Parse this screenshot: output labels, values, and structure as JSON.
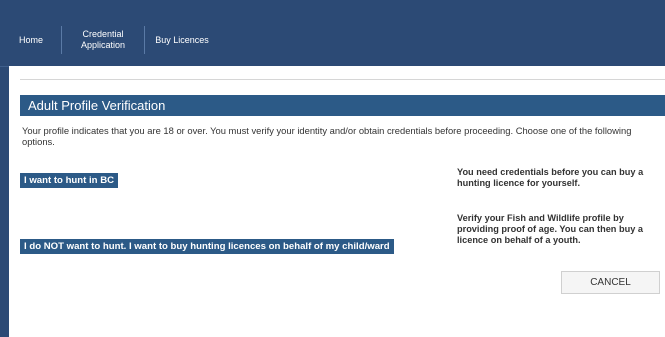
{
  "nav": {
    "home": "Home",
    "credential_line1": "Credential",
    "credential_line2": "Application",
    "buy_licences": "Buy Licences"
  },
  "panel": {
    "title": "Adult Profile Verification",
    "intro": "Your profile indicates that you are 18 or over. You must verify your identity and/or obtain credentials before proceeding. Choose one of the following options."
  },
  "options": [
    {
      "button_label": "I want to hunt in BC",
      "description": "You need credentials before you can buy a hunting licence for yourself."
    },
    {
      "button_label": "I do NOT want to hunt. I want to buy hunting licences on behalf of my child/ward",
      "description": "Verify your Fish and Wildlife profile by providing proof of age. You can then buy a licence on behalf of a youth."
    }
  ],
  "cancel_label": "CANCEL",
  "colors": {
    "header_bg": "#2c4a75",
    "accent": "#2c5a87"
  }
}
